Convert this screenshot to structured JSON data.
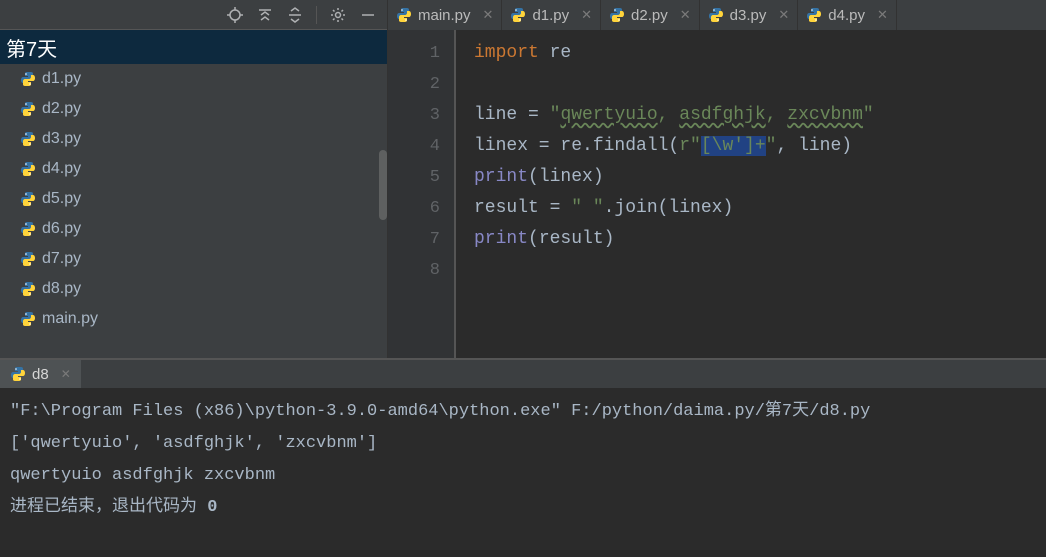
{
  "toolbar": {
    "icons": [
      "target",
      "collapse",
      "expand-sel",
      "settings",
      "minimize"
    ]
  },
  "tree": {
    "header": "第7天",
    "items": [
      {
        "icon": "py",
        "label": "d1.py"
      },
      {
        "icon": "py",
        "label": "d2.py"
      },
      {
        "icon": "py",
        "label": "d3.py"
      },
      {
        "icon": "py",
        "label": "d4.py"
      },
      {
        "icon": "py",
        "label": "d5.py"
      },
      {
        "icon": "py",
        "label": "d6.py"
      },
      {
        "icon": "py",
        "label": "d7.py"
      },
      {
        "icon": "py",
        "label": "d8.py"
      },
      {
        "icon": "py",
        "label": "main.py"
      }
    ]
  },
  "tabs": [
    {
      "label": "main.py",
      "active": false
    },
    {
      "label": "d1.py",
      "active": false
    },
    {
      "label": "d2.py",
      "active": false
    },
    {
      "label": "d3.py",
      "active": false
    },
    {
      "label": "d4.py",
      "active": false
    }
  ],
  "code": {
    "lines": [
      {
        "n": 1,
        "seg": [
          {
            "t": "import ",
            "c": "kw"
          },
          {
            "t": "re",
            "c": "ident"
          }
        ]
      },
      {
        "n": 2,
        "seg": []
      },
      {
        "n": 3,
        "seg": [
          {
            "t": "line = ",
            "c": "ident"
          },
          {
            "t": "\"",
            "c": "str"
          },
          {
            "t": "qwertyuio",
            "c": "str-u"
          },
          {
            "t": ", ",
            "c": "str"
          },
          {
            "t": "asdfghjk",
            "c": "str-u"
          },
          {
            "t": ", ",
            "c": "str"
          },
          {
            "t": "zxcvbnm",
            "c": "str-u"
          },
          {
            "t": "\"",
            "c": "str"
          }
        ]
      },
      {
        "n": 4,
        "seg": [
          {
            "t": "linex = re.findall(",
            "c": "ident"
          },
          {
            "t": "r\"",
            "c": "str"
          },
          {
            "t": "[\\w']+",
            "c": "str hl"
          },
          {
            "t": "\"",
            "c": "str"
          },
          {
            "t": ", line)",
            "c": "ident"
          }
        ]
      },
      {
        "n": 5,
        "seg": [
          {
            "t": "print",
            "c": "builtin"
          },
          {
            "t": "(linex)",
            "c": "ident"
          }
        ]
      },
      {
        "n": 6,
        "seg": [
          {
            "t": "result = ",
            "c": "ident"
          },
          {
            "t": "\" \"",
            "c": "str"
          },
          {
            "t": ".join(linex)",
            "c": "ident"
          }
        ]
      },
      {
        "n": 7,
        "seg": [
          {
            "t": "print",
            "c": "builtin"
          },
          {
            "t": "(result)",
            "c": "ident"
          }
        ]
      },
      {
        "n": 8,
        "seg": []
      }
    ]
  },
  "console": {
    "tab_label": "d8",
    "lines": [
      {
        "seg": [
          {
            "t": "\"F:\\Program Files (x86)\\python-3.9.0-amd64\\python.exe\" F:/python/daima.py/第7天/d8.py",
            "c": ""
          }
        ]
      },
      {
        "seg": [
          {
            "t": "['qwertyuio', 'asdfghjk', 'zxcvbnm']",
            "c": ""
          }
        ]
      },
      {
        "seg": [
          {
            "t": "qwertyuio asdfghjk zxcvbnm",
            "c": ""
          }
        ]
      },
      {
        "seg": [
          {
            "t": "",
            "c": ""
          }
        ]
      },
      {
        "seg": [
          {
            "t": "进程已结束，退出代码为 ",
            "c": ""
          },
          {
            "t": "0",
            "c": "c-bold"
          }
        ]
      }
    ]
  }
}
